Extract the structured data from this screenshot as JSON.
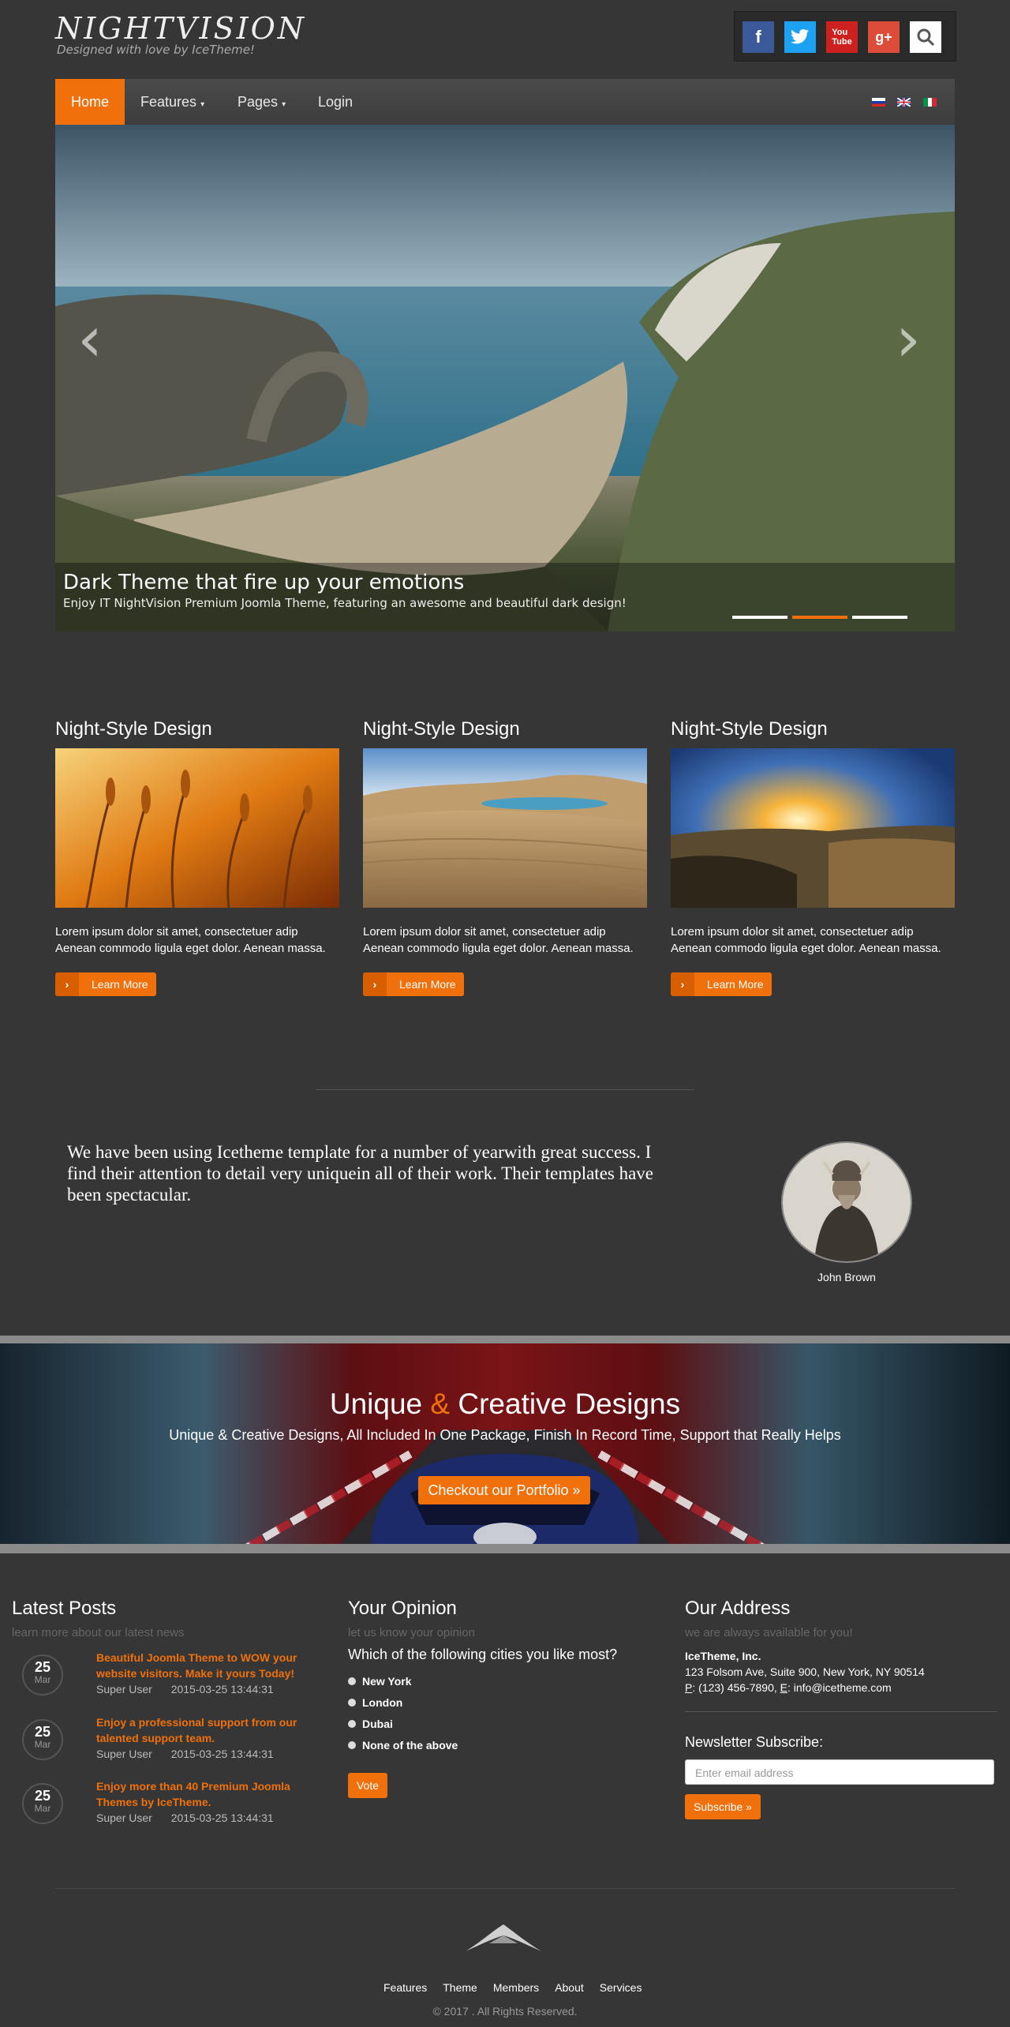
{
  "brand": {
    "title": "NIGHTVISION",
    "tagline": "Designed with love by IceTheme!"
  },
  "social": [
    "facebook-icon",
    "twitter-icon",
    "youtube-icon",
    "google-plus-icon",
    "search-icon"
  ],
  "nav": {
    "home": "Home",
    "features": "Features",
    "pages": "Pages",
    "login": "Login",
    "languages": [
      "ru-flag-icon",
      "uk-flag-icon",
      "it-flag-icon"
    ]
  },
  "slider": {
    "title": "Dark Theme that fire up your emotions",
    "subtitle": "Enjoy IT NightVision Premium Joomla Theme, featuring an awesome and beautiful dark design!",
    "active_slide": 2,
    "slide_count": 3
  },
  "features": [
    {
      "title": "Night-Style Design",
      "line1": "Lorem ipsum dolor sit amet, consectetuer adip",
      "line2": "Aenean commodo ligula eget dolor. Aenean massa.",
      "button": "Learn More"
    },
    {
      "title": "Night-Style Design",
      "line1": "Lorem ipsum dolor sit amet, consectetuer adip",
      "line2": "Aenean commodo ligula eget dolor. Aenean massa.",
      "button": "Learn More"
    },
    {
      "title": "Night-Style Design",
      "line1": "Lorem ipsum dolor sit amet, consectetuer adip",
      "line2": "Aenean commodo ligula eget dolor. Aenean massa.",
      "button": "Learn More"
    }
  ],
  "testimonial": {
    "line1": "We have been using Icetheme template for a number of yearwith great success. I",
    "line2": "find their attention to detail very uniquein all of their work. Their templates have",
    "line3": "been spectacular.",
    "name": "John Brown"
  },
  "banner": {
    "title_a": "Unique",
    "title_amp": "&",
    "title_b": "Creative Designs",
    "subtitle": "Unique & Creative Designs, All Included In One Package, Finish In Record Time, Support that Really Helps",
    "button": "Checkout our Portfolio »"
  },
  "latest_posts": {
    "title": "Latest Posts",
    "subtitle": "learn more about our latest news",
    "posts": [
      {
        "day": "25",
        "month": "Mar",
        "line1": "Beautiful Joomla Theme to WOW your",
        "line2": "website visitors. Make it yours Today!",
        "author": "Super User",
        "date": "2015-03-25 13:44:31"
      },
      {
        "day": "25",
        "month": "Mar",
        "line1": "Enjoy a professional support from our",
        "line2": "talented support team.",
        "author": "Super User",
        "date": "2015-03-25 13:44:31"
      },
      {
        "day": "25",
        "month": "Mar",
        "line1": "Enjoy more than 40 Premium Joomla",
        "line2": "Themes by IceTheme.",
        "author": "Super User",
        "date": "2015-03-25 13:44:31"
      }
    ]
  },
  "poll": {
    "title": "Your Opinion",
    "subtitle": "let us know your opinion",
    "question": "Which of the following cities you like most?",
    "options": [
      "New York",
      "London",
      "Dubai",
      "None of the above"
    ],
    "button": "Vote"
  },
  "address": {
    "title": "Our Address",
    "subtitle": "we are always available for you!",
    "company": "IceTheme, Inc.",
    "street": "123 Folsom Ave, Suite 900, New York, NY 90514",
    "p_label": "P",
    "phone": ": (123) 456-7890, ",
    "e_label": "E",
    "email": ": info@icetheme.com",
    "newsletter_title": "Newsletter Subscribe:",
    "email_placeholder": "Enter email address",
    "subscribe_button": "Subscribe »"
  },
  "footer": {
    "links": [
      "Features",
      "Theme",
      "Members",
      "About",
      "Services"
    ],
    "copyright": "© 2017 . All Rights Reserved."
  },
  "colors": {
    "accent": "#f0700b",
    "background": "#363636"
  }
}
